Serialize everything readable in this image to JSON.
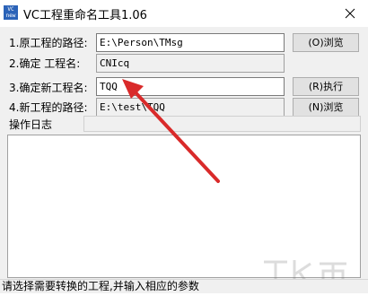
{
  "window": {
    "icon_text": "VC\nnew",
    "title": "VC工程重命名工具1.06"
  },
  "form": {
    "source_path": {
      "label": "1.原工程的路径:",
      "value": "E:\\Person\\TMsg",
      "button": "(O)浏览"
    },
    "confirm": {
      "label": "2.确定  工程名:",
      "value": "CNIcq"
    },
    "new_name": {
      "label": "3.确定新工程名:",
      "value": "TQQ",
      "button": "(R)执行"
    },
    "new_path": {
      "label": "4.新工程的路径:",
      "value": "E:\\test\\TQQ",
      "button": "(N)浏览"
    }
  },
  "log": {
    "label": "操作日志"
  },
  "status": {
    "text": "请选择需要转换的工程,并输入相应的参数"
  },
  "annotation": {
    "arrow_color": "#d92a2a"
  }
}
